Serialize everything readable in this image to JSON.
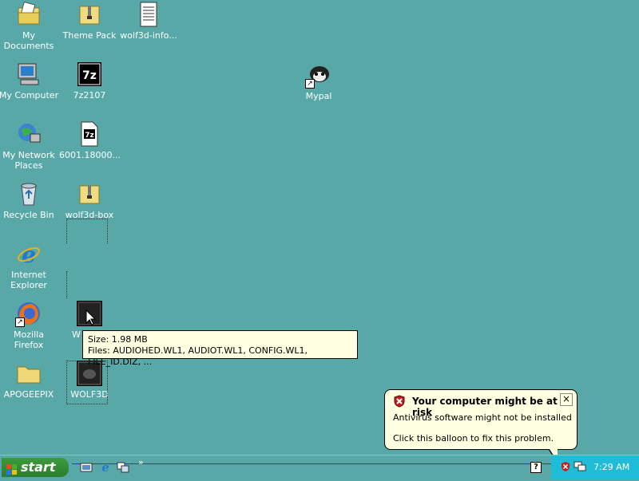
{
  "desktop": {
    "icons": [
      {
        "label": "My Documents",
        "icon": "my-documents-icon"
      },
      {
        "label": "Theme Pack",
        "icon": "zip-folder-icon"
      },
      {
        "label": "wolf3d-info...",
        "icon": "text-document-icon"
      },
      {
        "label": "My Computer",
        "icon": "computer-icon"
      },
      {
        "label": "7z2107",
        "icon": "7zip-icon"
      },
      {
        "label": "Mypal",
        "icon": "mypal-browser-icon"
      },
      {
        "label": "My Network Places",
        "icon": "network-places-icon"
      },
      {
        "label": "6001.18000...",
        "icon": "7z-archive-icon"
      },
      {
        "label": "Recycle Bin",
        "icon": "recycle-bin-icon"
      },
      {
        "label": "wolf3d-box",
        "icon": "zip-folder-icon"
      },
      {
        "label": "Internet Explorer",
        "icon": "internet-explorer-icon"
      },
      {
        "label": "Mozilla Firefox",
        "icon": "firefox-icon"
      },
      {
        "label": "W",
        "icon": "dos-program-icon"
      },
      {
        "label": "APOGEEPIX",
        "icon": "folder-icon"
      },
      {
        "label": "WOLF3D",
        "icon": "dos-program-icon"
      }
    ]
  },
  "tooltip": {
    "size": "Size: 1.98 MB",
    "files": "Files: AUDIOHED.WL1, AUDIOT.WL1, CONFIG.WL1, FILE_ID.DIZ, ..."
  },
  "balloon": {
    "title": "Your computer might be at risk",
    "line1": "Antivirus software might not be installed",
    "line2": "Click this balloon to fix this problem.",
    "close": "×"
  },
  "taskbar": {
    "start_label": "start",
    "quicklaunch_chevron": "»",
    "help_glyph": "?",
    "clock": "7:29 AM"
  }
}
